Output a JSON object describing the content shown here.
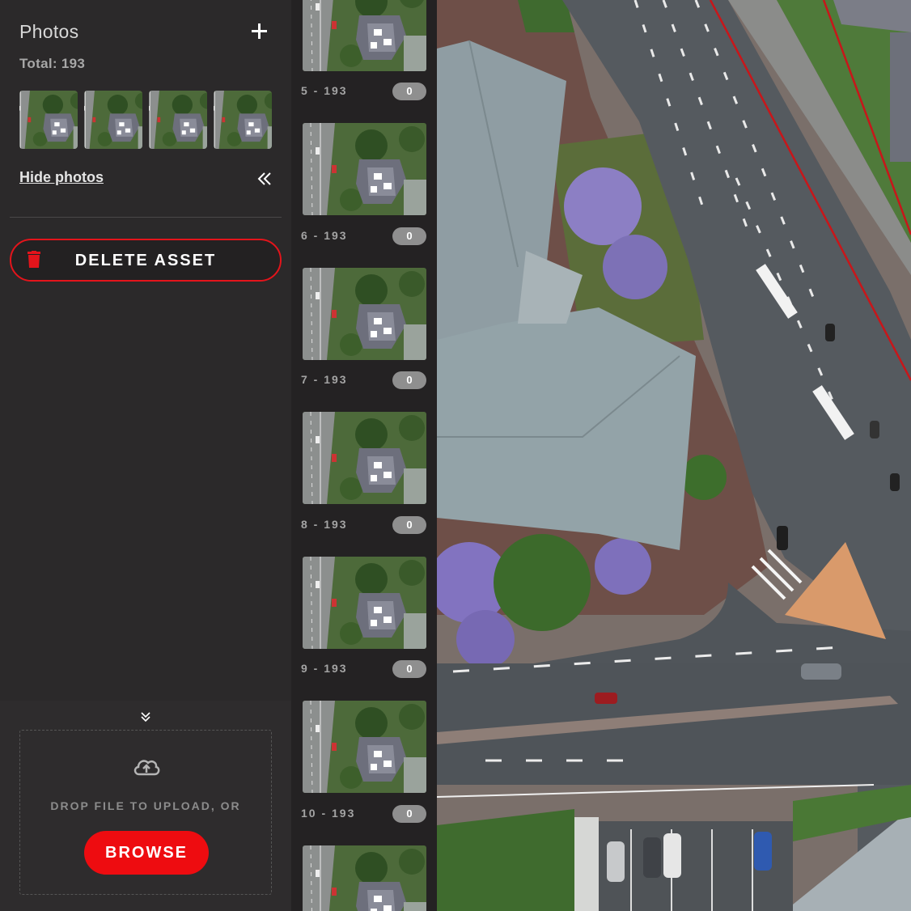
{
  "sidebar": {
    "title": "Photos",
    "total_text": "Total: 193",
    "hide_photos_label": "Hide photos",
    "delete_label": "DELETE ASSET",
    "thumbnail_count": 4
  },
  "upload": {
    "drop_text": "DROP FILE TO UPLOAD, OR",
    "browse_label": "BROWSE"
  },
  "photos": [
    {
      "label": "5 - 193",
      "count": "0"
    },
    {
      "label": "6 - 193",
      "count": "0"
    },
    {
      "label": "7 - 193",
      "count": "0"
    },
    {
      "label": "8 - 193",
      "count": "0"
    },
    {
      "label": "9 - 193",
      "count": "0"
    },
    {
      "label": "10 - 193",
      "count": "0"
    }
  ],
  "icons": {
    "add": "plus-icon",
    "collapse": "double-chevron-left-icon",
    "delete": "trash-icon",
    "upload_collapse": "double-chevron-down-icon",
    "upload": "cloud-upload-icon"
  },
  "colors": {
    "accent_red": "#ee0c10",
    "sidebar_bg": "#2b292a",
    "badge_grey": "#8f8f8f"
  }
}
